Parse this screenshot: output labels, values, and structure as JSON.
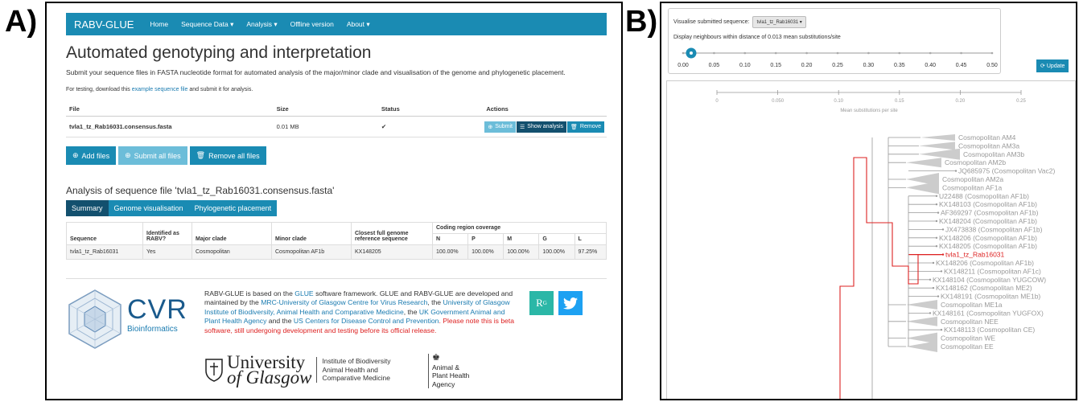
{
  "panel_labels": {
    "a": "A)",
    "b": "B)"
  },
  "app": {
    "brand": "RABV-GLUE",
    "nav": [
      "Home",
      "Sequence Data ▾",
      "Analysis ▾",
      "Offline version",
      "About ▾"
    ],
    "title": "Automated genotyping and interpretation",
    "intro": "Submit your sequence files in FASTA nucleotide format for automated analysis of the major/minor clade and visualisation of the genome and phylogenetic placement.",
    "test_prefix": "For testing, download this",
    "test_link": "example sequence file",
    "test_suffix": "and submit it for analysis.",
    "file_table": {
      "headers": [
        "File",
        "Size",
        "Status",
        "Actions"
      ],
      "row": {
        "file": "tvla1_tz_Rab16031.consensus.fasta",
        "size": "0.01 MB",
        "status": "✔"
      },
      "actions": [
        "Submit",
        "Show analysis",
        "Remove"
      ]
    },
    "big_buttons": [
      "Add files",
      "Submit all files",
      "Remove all files"
    ],
    "analysis_title": "Analysis of sequence file 'tvla1_tz_Rab16031.consensus.fasta'",
    "tabs": [
      "Summary",
      "Genome visualisation",
      "Phylogenetic placement"
    ],
    "summary_table": {
      "headers": [
        "Sequence",
        "Identified as RABV?",
        "Major clade",
        "Minor clade",
        "Closest full genome reference sequence"
      ],
      "coverage_header": "Coding region coverage",
      "genes": [
        "N",
        "P",
        "M",
        "G",
        "L"
      ],
      "row": {
        "sequence": "tvla1_tz_Rab16031",
        "identified": "Yes",
        "major": "Cosmopolitan",
        "minor": "Cosmopolitan AF1b",
        "closest": "KX148205",
        "coverage": [
          "100.00%",
          "100.00%",
          "100.00%",
          "100.00%",
          "97.25%"
        ]
      }
    },
    "footer": {
      "cvr": "CVR",
      "cvr_sub": "Bioinformatics",
      "about_1": "RABV-GLUE is based on the",
      "glue": "GLUE",
      "about_2": "software framework. GLUE and RABV-GLUE are developed and maintained by the",
      "mrc": "MRC-University of Glasgow Centre for Virus Research",
      "about_3": ", the",
      "ibahcm": "University of Glasgow Institute of Biodiversity, Animal Health and Comparative Medicine",
      "about_4": ", the",
      "apha_link": "UK Government Animal and Plant Health Agency",
      "about_5": "and the",
      "cdc": "US Centers for Disease Control and Prevention",
      "beta": ". Please note this is beta software, still undergoing development and testing before its official release.",
      "rg": "R",
      "uni_1": "University",
      "uni_2": "of Glasgow",
      "inst": [
        "Institute of Biodiversity",
        "Animal Health and",
        "Comparative Medicine"
      ],
      "apha": [
        "Animal &",
        "Plant Health",
        "Agency"
      ]
    }
  },
  "phylo": {
    "visualise_label": "Visualise submitted sequence:",
    "selected": "tvla1_tz_Rab16031 ▾",
    "distance_text": "Display neighbours within distance of 0.013 mean substitutions/site",
    "slider_ticks": [
      "0.00",
      "0.05",
      "0.10",
      "0.15",
      "0.20",
      "0.25",
      "0.30",
      "0.35",
      "0.40",
      "0.45",
      "0.50"
    ],
    "slider_value": 0.013,
    "update": "Update",
    "scale_ticks": [
      "0",
      "0.050",
      "0.10",
      "0.15",
      "0.20",
      "0.25"
    ],
    "scale_label": "Mean substitutions per site",
    "leaves": [
      "Cosmopolitan AM4",
      "Cosmopolitan AM3a",
      "Cosmopolitan AM3b",
      "Cosmopolitan AM2b",
      "JQ685975 (Cosmopolitan Vac2)",
      "Cosmopolitan AM2a",
      "Cosmopolitan AF1a",
      "U22488 (Cosmopolitan AF1b)",
      "KX148103 (Cosmopolitan AF1b)",
      "AF369297 (Cosmopolitan AF1b)",
      "KX148204 (Cosmopolitan AF1b)",
      "JX473838 (Cosmopolitan AF1b)",
      "KX148206 (Cosmopolitan AF1b)",
      "KX148205 (Cosmopolitan AF1b)",
      "tvla1_tz_Rab16031",
      "KX148206 (Cosmopolitan AF1b)",
      "KX148211 (Cosmopolitan AF1c)",
      "KX148104 (Cosmopolitan YUGCOW)",
      "KX148162 (Cosmopolitan ME2)",
      "KX148191 (Cosmopolitan ME1b)",
      "Cosmopolitan ME1a",
      "KX148161 (Cosmopolitan YUGFOX)",
      "Cosmopolitan NEE",
      "KX148113 (Cosmopolitan CE)",
      "Cosmopolitan WE",
      "Cosmopolitan EE"
    ],
    "highlight": "tvla1_tz_Rab16031",
    "colors": {
      "highlight": "#dd2222",
      "branch": "#999999",
      "accent": "#1a8bb3"
    }
  }
}
